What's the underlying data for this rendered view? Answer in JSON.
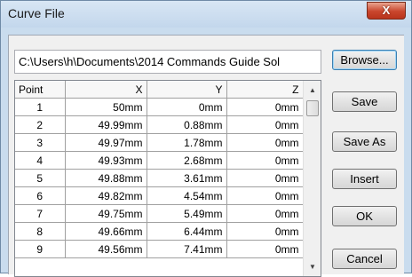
{
  "window": {
    "title": "Curve File",
    "close_label": "X"
  },
  "path": {
    "value": "C:\\Users\\h\\Documents\\2014 Commands Guide Sol"
  },
  "table": {
    "headers": [
      "Point",
      "X",
      "Y",
      "Z"
    ],
    "rows": [
      [
        "1",
        "50mm",
        "0mm",
        "0mm"
      ],
      [
        "2",
        "49.99mm",
        "0.88mm",
        "0mm"
      ],
      [
        "3",
        "49.97mm",
        "1.78mm",
        "0mm"
      ],
      [
        "4",
        "49.93mm",
        "2.68mm",
        "0mm"
      ],
      [
        "5",
        "49.88mm",
        "3.61mm",
        "0mm"
      ],
      [
        "6",
        "49.82mm",
        "4.54mm",
        "0mm"
      ],
      [
        "7",
        "49.75mm",
        "5.49mm",
        "0mm"
      ],
      [
        "8",
        "49.66mm",
        "6.44mm",
        "0mm"
      ],
      [
        "9",
        "49.56mm",
        "7.41mm",
        "0mm"
      ]
    ]
  },
  "scrollbar": {
    "up_icon": "up-arrow",
    "down_icon": "down-arrow"
  },
  "buttons": {
    "browse": "Browse...",
    "save": "Save",
    "save_as": "Save As",
    "insert": "Insert",
    "ok": "OK",
    "cancel": "Cancel"
  }
}
